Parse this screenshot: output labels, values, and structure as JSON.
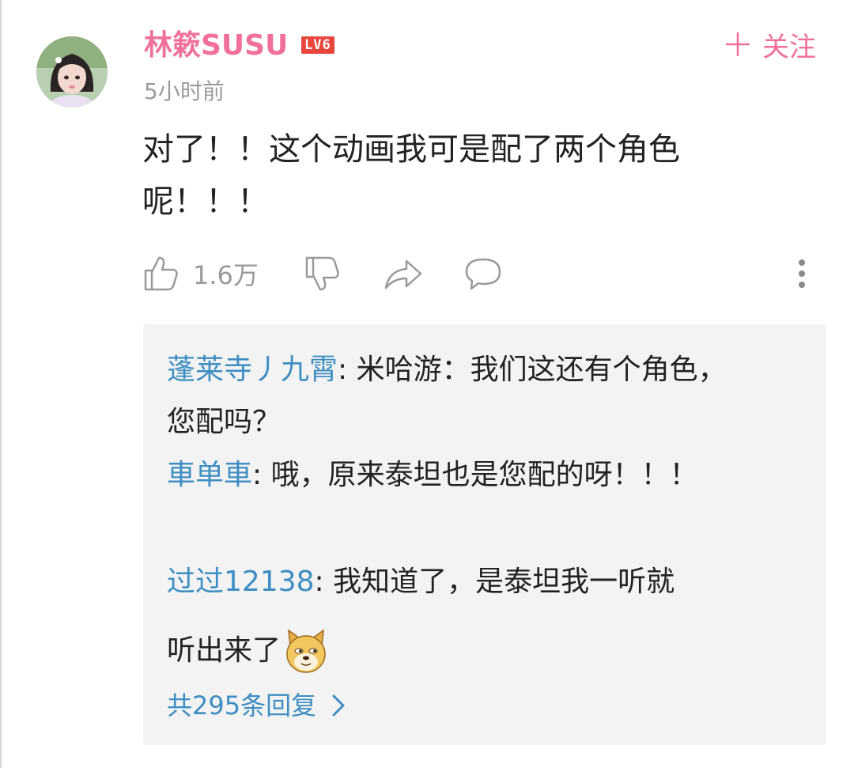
{
  "comment": {
    "username": "林簌SUSU",
    "level": "LV6",
    "follow_label": "关注",
    "follow_icon": "plus-icon",
    "time": "5小时前",
    "text": "对了！！这个动画我可是配了两个角色呢！！！",
    "like_count": "1.6万",
    "accent_color": "#f0709a"
  },
  "replies": {
    "items": [
      {
        "name": "蓬莱寺丿九霄",
        "text": ": 米哈游：我们这还有个角色，您配吗？"
      },
      {
        "name": "車单車",
        "text": ": 哦，原来泰坦也是您配的呀！！！"
      },
      {
        "name": "过过12138",
        "text": ": 我知道了，是泰坦我一听就",
        "text2": "听出来了"
      }
    ],
    "more_label": "共295条回复",
    "link_color": "#3d8ec2"
  }
}
